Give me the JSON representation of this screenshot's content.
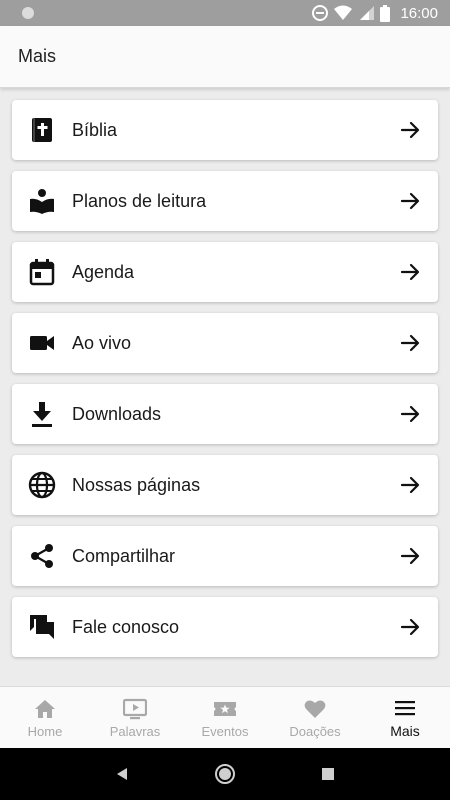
{
  "status_bar": {
    "time": "16:00"
  },
  "header": {
    "title": "Mais"
  },
  "menu": {
    "items": [
      {
        "label": "Bíblia",
        "icon": "bible-icon"
      },
      {
        "label": "Planos de leitura",
        "icon": "reading-plans-icon"
      },
      {
        "label": "Agenda",
        "icon": "calendar-icon"
      },
      {
        "label": "Ao vivo",
        "icon": "video-camera-icon"
      },
      {
        "label": "Downloads",
        "icon": "download-icon"
      },
      {
        "label": "Nossas páginas",
        "icon": "globe-icon"
      },
      {
        "label": "Compartilhar",
        "icon": "share-icon"
      },
      {
        "label": "Fale conosco",
        "icon": "chat-icon"
      }
    ]
  },
  "bottom_nav": {
    "items": [
      {
        "label": "Home",
        "icon": "home-icon",
        "active": false
      },
      {
        "label": "Palavras",
        "icon": "play-screen-icon",
        "active": false
      },
      {
        "label": "Eventos",
        "icon": "ticket-star-icon",
        "active": false
      },
      {
        "label": "Doações",
        "icon": "heart-icon",
        "active": false
      },
      {
        "label": "Mais",
        "icon": "menu-icon",
        "active": true
      }
    ]
  },
  "colors": {
    "inactive_nav": "#a8a8a8",
    "active_nav": "#111111",
    "background": "#ececec"
  }
}
